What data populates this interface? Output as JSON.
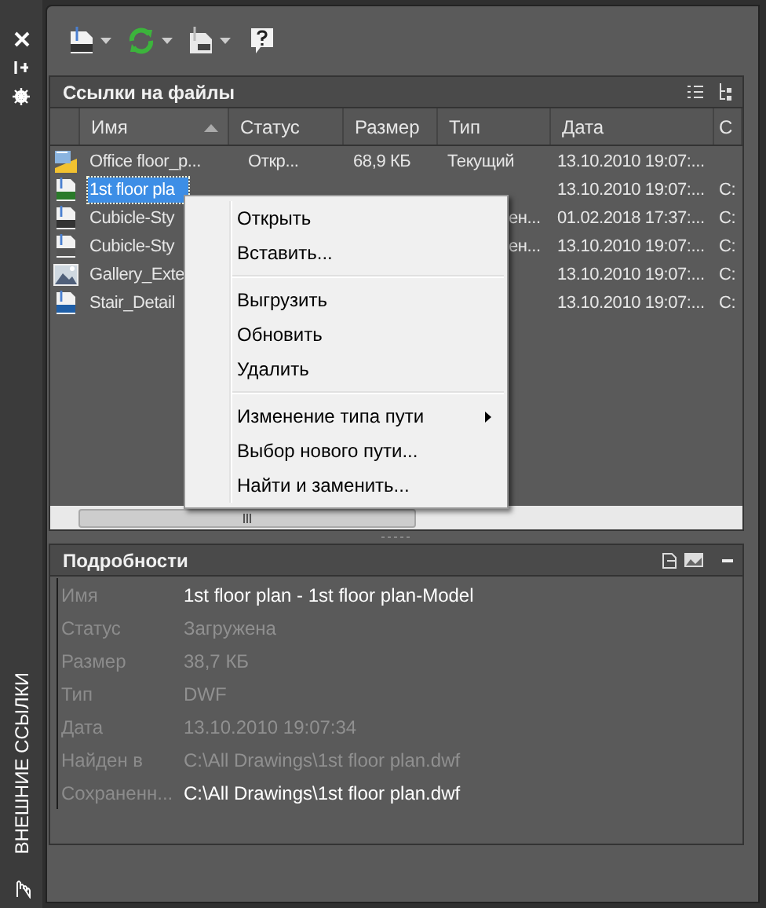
{
  "palette_title": "ВНЕШНИЕ ССЫЛКИ",
  "file_references": {
    "title": "Ссылки на файлы",
    "columns": [
      {
        "label": "Имя",
        "sorted": true
      },
      {
        "label": "Статус",
        "sorted": false
      },
      {
        "label": "Размер",
        "sorted": false
      },
      {
        "label": "Тип",
        "sorted": false
      },
      {
        "label": "Дата",
        "sorted": false
      },
      {
        "label": "С",
        "sorted": false
      }
    ],
    "rows": [
      {
        "kind": "current",
        "selected": false,
        "cells": [
          "Office floor_p...",
          "Откр...",
          "68,9 КБ",
          "Текущий",
          "13.10.2010 19:07:...",
          ""
        ]
      },
      {
        "kind": "dwf",
        "selected": true,
        "cells": [
          "1st floor pla",
          "",
          "",
          "",
          "13.10.2010 19:07:...",
          "C:"
        ]
      },
      {
        "kind": "dwg",
        "selected": false,
        "cells": [
          "Cubicle-Sty",
          "",
          "",
          "ен...",
          "01.02.2018 17:37:...",
          "C:"
        ]
      },
      {
        "kind": "xref",
        "selected": false,
        "cells": [
          "Cubicle-Sty",
          "",
          "",
          "ен...",
          "13.10.2010 19:07:...",
          "C:"
        ]
      },
      {
        "kind": "image",
        "selected": false,
        "cells": [
          "Gallery_Exte",
          "",
          "",
          "",
          "13.10.2010 19:07:...",
          "C:"
        ]
      },
      {
        "kind": "dgn",
        "selected": false,
        "cells": [
          "Stair_Detail",
          "",
          "",
          "",
          "13.10.2010 19:07:...",
          "C:"
        ]
      }
    ]
  },
  "context_menu": [
    {
      "kind": "item",
      "label": "Открыть",
      "submenu": false
    },
    {
      "kind": "item",
      "label": "Вставить...",
      "submenu": false
    },
    {
      "kind": "separator"
    },
    {
      "kind": "item",
      "label": "Выгрузить",
      "submenu": false
    },
    {
      "kind": "item",
      "label": "Обновить",
      "submenu": false
    },
    {
      "kind": "item",
      "label": "Удалить",
      "submenu": false
    },
    {
      "kind": "separator"
    },
    {
      "kind": "item",
      "label": "Изменение типа пути",
      "submenu": true
    },
    {
      "kind": "item",
      "label": "Выбор нового пути...",
      "submenu": false
    },
    {
      "kind": "item",
      "label": "Найти и заменить...",
      "submenu": false
    }
  ],
  "details": {
    "title": "Подробности",
    "rows": [
      {
        "label": "Имя",
        "value": "1st floor plan - 1st floor plan-Model",
        "disabled": false
      },
      {
        "label": "Статус",
        "value": "Загружена",
        "disabled": true
      },
      {
        "label": "Размер",
        "value": "38,7 КБ",
        "disabled": true
      },
      {
        "label": "Тип",
        "value": "DWF",
        "disabled": true
      },
      {
        "label": "Дата",
        "value": "13.10.2010 19:07:34",
        "disabled": true
      },
      {
        "label": "Найден в",
        "value": "C:\\All Drawings\\1st floor plan.dwf",
        "disabled": true
      },
      {
        "label": "Сохраненн...",
        "value": "C:\\All Drawings\\1st floor plan.dwf",
        "disabled": false
      }
    ]
  }
}
